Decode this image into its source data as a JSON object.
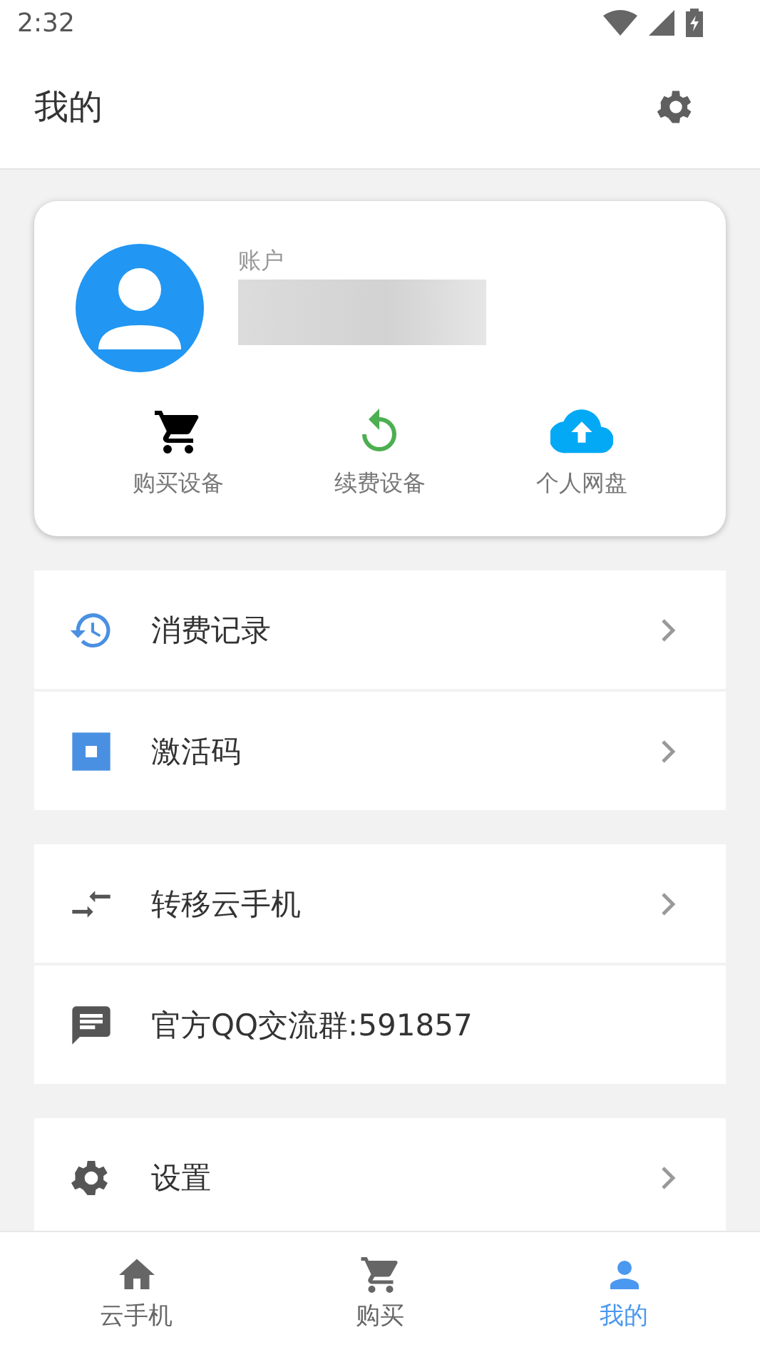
{
  "status_bar": {
    "time": "2:32"
  },
  "header": {
    "title": "我的"
  },
  "account": {
    "label": "账户"
  },
  "quick_actions": [
    {
      "kind": "cart",
      "label": "购买设备"
    },
    {
      "kind": "renew",
      "label": "续费设备"
    },
    {
      "kind": "cloud",
      "label": "个人网盘"
    }
  ],
  "menu_groups": [
    {
      "items": [
        {
          "kind": "history",
          "label": "消费记录",
          "chevron": true
        },
        {
          "kind": "code",
          "label": "激活码",
          "chevron": true
        }
      ]
    },
    {
      "items": [
        {
          "kind": "transfer",
          "label": "转移云手机",
          "chevron": true
        },
        {
          "kind": "chat",
          "label": "官方QQ交流群:591857",
          "chevron": false
        }
      ]
    },
    {
      "items": [
        {
          "kind": "settings",
          "label": "设置",
          "chevron": true
        }
      ]
    }
  ],
  "bottom_nav": [
    {
      "kind": "home",
      "label": "云手机",
      "selected": false
    },
    {
      "kind": "cart",
      "label": "购买",
      "selected": false
    },
    {
      "kind": "person",
      "label": "我的",
      "selected": true
    }
  ]
}
